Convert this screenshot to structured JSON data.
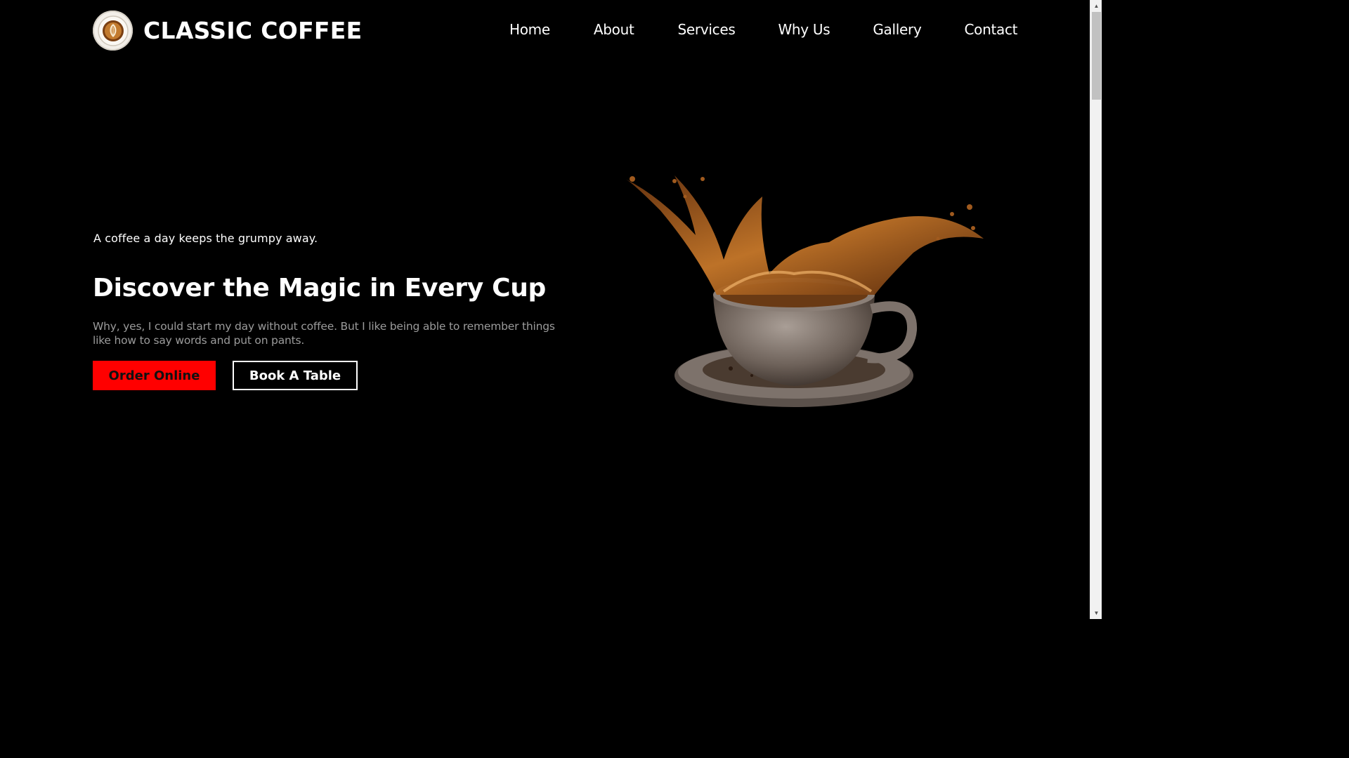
{
  "brand": {
    "name": "CLASSIC COFFEE",
    "logo_icon": "coffee-cup-logo"
  },
  "nav": {
    "items": [
      {
        "label": "Home"
      },
      {
        "label": "About"
      },
      {
        "label": "Services"
      },
      {
        "label": "Why Us"
      },
      {
        "label": "Gallery"
      },
      {
        "label": "Contact"
      }
    ]
  },
  "hero": {
    "tagline": "A coffee a day keeps the grumpy away.",
    "headline": "Discover the Magic in Every Cup",
    "description": "Why, yes, I could start my day without coffee. But I like being able to remember things like how to say words and put on pants.",
    "order_button": "Order Online",
    "book_button": "Book A Table",
    "image_icon": "coffee-splash-cup-image"
  },
  "colors": {
    "background": "#000000",
    "accent": "#ff0000",
    "text": "#ffffff",
    "muted": "#9b9b9b"
  }
}
